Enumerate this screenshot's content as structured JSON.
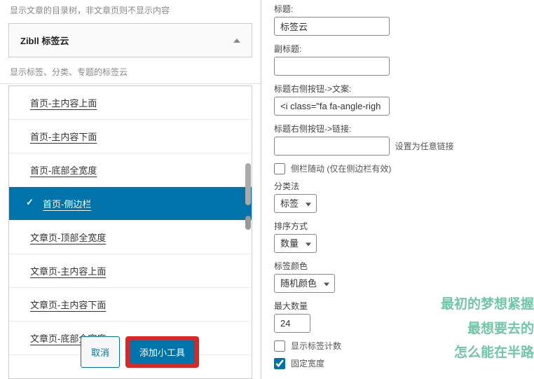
{
  "left": {
    "top_hint": "显示文章的目录树，非文章页则不显示内容",
    "header_title": "Zibll 标签云",
    "desc": "显示标签、分类、专题的标签云",
    "options": [
      "首页-主内容上面",
      "首页-主内容下面",
      "首页-底部全宽度",
      "首页-侧边栏",
      "文章页-顶部全宽度",
      "文章页-主内容上面",
      "文章页-主内容下面",
      "文章页-底部全宽度"
    ],
    "selected_index": 3,
    "cancel_label": "取消",
    "add_label": "添加小工具"
  },
  "right": {
    "title_label": "标题:",
    "title_value": "标签云",
    "subtitle_label": "副标题:",
    "subtitle_value": "",
    "btn_text_label": "标题右侧按钮->文案:",
    "btn_text_value": "<i class=\"fa fa-angle-righ",
    "btn_link_label": "标题右侧按钮->链接:",
    "btn_link_value": "",
    "btn_link_hint": "设置为任意链接",
    "sidebar_follow_label": "侧栏随动 (仅在侧边栏有效)",
    "sidebar_follow_checked": false,
    "taxonomy_label": "分类法",
    "taxonomy_value": "标签",
    "sort_label": "排序方式",
    "sort_value": "数量",
    "color_label": "标签颜色",
    "color_value": "随机颜色",
    "max_label": "最大数量",
    "max_value": "24",
    "show_count_label": "显示标签计数",
    "show_count_checked": false,
    "fixed_width_label": "固定宽度",
    "fixed_width_checked": true
  },
  "watermark": {
    "line1": "最初的梦想紧握",
    "line2": "最想要去的",
    "line3": "怎么能在半路"
  }
}
